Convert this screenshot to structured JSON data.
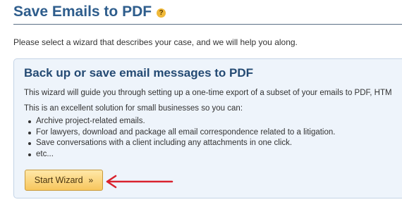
{
  "header": {
    "title": "Save Emails to PDF",
    "help_glyph": "?"
  },
  "intro": {
    "text": "Please select a wizard that describes your case, and we will help you along."
  },
  "wizard": {
    "title": "Back up or save email messages to PDF",
    "description": "This wizard will guide you through setting up a one-time export of a subset of your emails to PDF, HTM",
    "lead": "This is an excellent solution for small businesses so you can:",
    "bullets": [
      "Archive project-related emails.",
      "For lawyers, download and package all email correspondence related to a litigation.",
      "Save conversations with a client including any attachments in one click.",
      "etc..."
    ],
    "button_label": "Start Wizard",
    "button_chevron": "»"
  },
  "colors": {
    "title": "#2e5d8c",
    "panel_bg": "#eef4fb",
    "button": "#f7c65d",
    "arrow": "#d9232e"
  },
  "icons": {
    "help": "help-icon",
    "pointer": "red-arrow-icon"
  }
}
